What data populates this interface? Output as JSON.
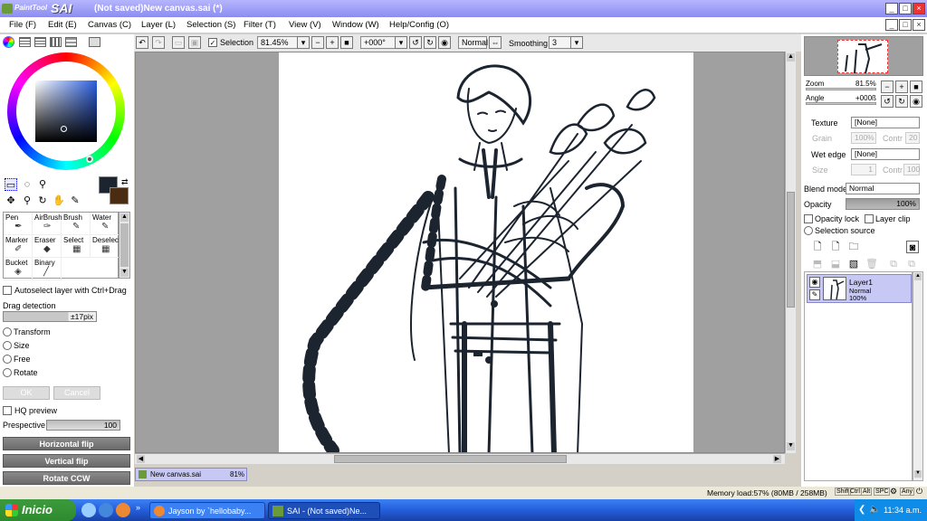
{
  "app": {
    "logo_small": "PaintTool",
    "logo_big": "SAI",
    "title": "(Not saved)New canvas.sai (*)"
  },
  "menu": [
    "File (F)",
    "Edit (E)",
    "Canvas (C)",
    "Layer (L)",
    "Selection (S)",
    "Filter (T)",
    "View (V)",
    "Window (W)",
    "Help/Config (O)"
  ],
  "toolbar": {
    "selection_label": "Selection",
    "selection_checked": true,
    "zoom": "81.45%",
    "rotation": "+000°",
    "blend": "Normal",
    "smoothing_label": "Smoothing",
    "smoothing_value": "3"
  },
  "left": {
    "brushes": [
      {
        "label": "Pen"
      },
      {
        "label": "AirBrush"
      },
      {
        "label": "Brush"
      },
      {
        "label": "Water"
      },
      {
        "label": "Marker"
      },
      {
        "label": "Eraser"
      },
      {
        "label": "Select"
      },
      {
        "label": "Deselect"
      },
      {
        "label": "Bucket"
      },
      {
        "label": "Binary"
      }
    ],
    "autoselect_label": "Autoselect layer with Ctrl+Drag",
    "drag_detection_label": "Drag detection",
    "drag_detection_value": "±17pix",
    "transform_options": [
      "Transform",
      "Size",
      "Free",
      "Rotate"
    ],
    "ok_label": "OK",
    "cancel_label": "Cancel",
    "hq_preview_label": "HQ preview",
    "perspective_label": "Prespective",
    "perspective_value": "100",
    "flip_buttons": [
      "Horizontal flip",
      "Vertical flip",
      "Rotate CCW"
    ]
  },
  "canvas": {
    "doc_tab_name": "New canvas.sai",
    "doc_tab_zoom": "81%"
  },
  "right": {
    "zoom_label": "Zoom",
    "zoom_value": "81.5%",
    "angle_label": "Angle",
    "angle_value": "+000ß",
    "texture_label": "Texture",
    "texture_value": "[None]",
    "grain_label": "Grain",
    "grain_value": "100%",
    "contr_label": "Contr",
    "contr_value": "20",
    "wetedge_label": "Wet edge",
    "wetedge_value": "[None]",
    "size_label": "Size",
    "size_value": "1",
    "contr2_value": "100",
    "blend_mode_label": "Blend mode",
    "blend_mode_value": "Normal",
    "opacity_label": "Opacity",
    "opacity_value": "100%",
    "opacity_lock_label": "Opacity lock",
    "layer_clip_label": "Layer clip",
    "selection_source_label": "Selection source",
    "layer": {
      "name": "Layer1",
      "mode": "Normal",
      "opacity": "100%"
    }
  },
  "status": {
    "memory": "Memory load:57% (80MB / 258MB)",
    "keys": [
      "Shift",
      "Ctrl",
      "Alt",
      "SPC",
      "Any"
    ]
  },
  "taskbar": {
    "start_label": "Inicio",
    "tasks": [
      "Jayson by `hellobaby...",
      "SAI - (Not saved)Ne..."
    ],
    "clock": "11:34 a.m."
  },
  "colors": {
    "primary": "#1c2430",
    "secondary": "#4a2c12",
    "accent": "#8c8cf0"
  }
}
